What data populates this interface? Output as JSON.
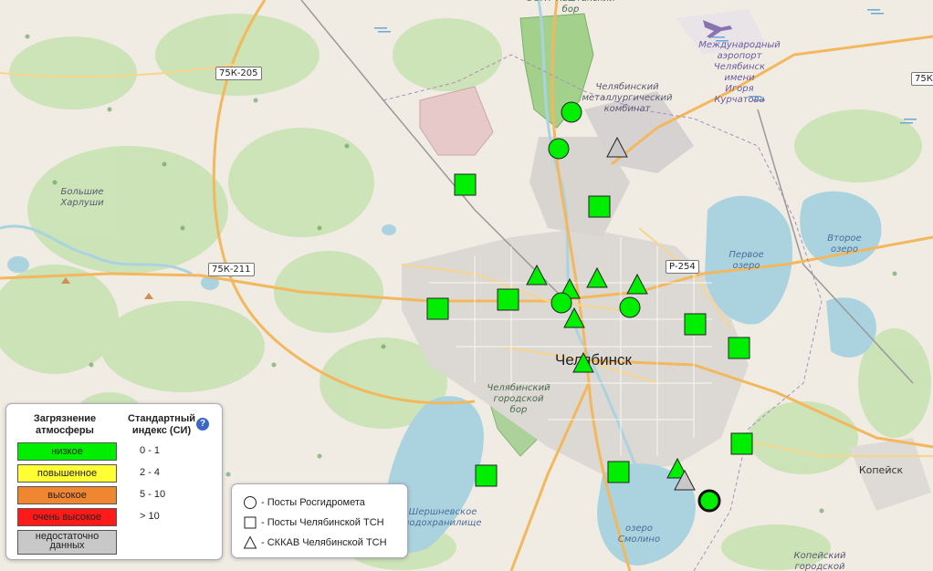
{
  "map": {
    "labels": {
      "chelyabinsk": "Челябинск",
      "kopeysk": "Копейск",
      "airport": "Международный\nаэропорт\nЧелябинск\nимени\nИгоря\nКурчатова",
      "metallurg": "Челябинский\nметаллургический\nкомбинат",
      "kashtak": "ООПТ Каштакский\nбор",
      "bolshie": "Большие\nХарлуши",
      "pervoe": "Первое\nозеро",
      "vtoroe": "Второе\nозеро",
      "smolino": "озеро\nСмолино",
      "pine": "Челябинский\nгородской\nбор",
      "reservoir": "Шершневское\nводохранилище",
      "kopeysk_bor": "Копейский\nгородской"
    },
    "shields": {
      "r205": "75К-205",
      "r211": "75К-211",
      "p254": "Р-254",
      "r75k": "75К"
    }
  },
  "monitoring_posts": {
    "status_colors": {
      "low": "#00ee00",
      "gray": "#c8c8c8"
    },
    "posts": [
      {
        "type": "circle",
        "status": "low"
      },
      {
        "type": "circle",
        "status": "low"
      },
      {
        "type": "triangle",
        "status": "gray"
      },
      {
        "type": "square",
        "status": "low"
      },
      {
        "type": "square",
        "status": "low"
      },
      {
        "type": "triangle",
        "status": "low"
      },
      {
        "type": "triangle",
        "status": "low"
      },
      {
        "type": "triangle",
        "status": "low"
      },
      {
        "type": "triangle",
        "status": "low"
      },
      {
        "type": "circle",
        "status": "low"
      },
      {
        "type": "triangle",
        "status": "low"
      },
      {
        "type": "circle",
        "status": "low"
      },
      {
        "type": "square",
        "status": "low"
      },
      {
        "type": "square",
        "status": "low"
      },
      {
        "type": "square",
        "status": "low"
      },
      {
        "type": "square",
        "status": "low"
      },
      {
        "type": "triangle",
        "status": "low"
      },
      {
        "type": "square",
        "status": "low"
      },
      {
        "type": "square",
        "status": "low"
      },
      {
        "type": "square",
        "status": "low"
      },
      {
        "type": "triangle",
        "status": "low"
      },
      {
        "type": "triangle",
        "status": "gray"
      },
      {
        "type": "circle",
        "status": "low",
        "highlight": true
      }
    ]
  },
  "legend": {
    "title_pollution": "Загрязнение\nатмосферы",
    "title_index": "Стандартный\nиндекс (СИ)",
    "help_icon": "?",
    "levels": [
      {
        "label": "низкое",
        "color": "#00ee00",
        "range": "0  -  1"
      },
      {
        "label": "повышенное",
        "color": "#ffff33",
        "range": "2  -  4"
      },
      {
        "label": "высокое",
        "color": "#f0862f",
        "range": "5  -  10"
      },
      {
        "label": "очень высокое",
        "color": "#ff1a1a",
        "range": "      >  10"
      },
      {
        "label": "недостаточно\nданных",
        "color": "#c8c8c8",
        "range": ""
      }
    ]
  },
  "symbol_legend": {
    "circle": "- Посты Росгидромета",
    "square": "- Посты Челябинской ТСН",
    "triangle": "- СККАВ Челябинской ТСН"
  }
}
